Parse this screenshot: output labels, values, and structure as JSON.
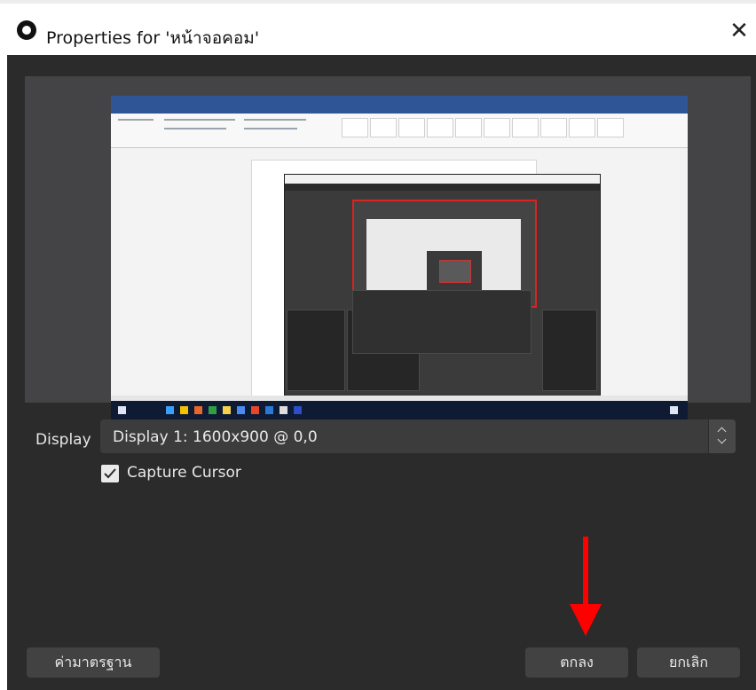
{
  "dialog": {
    "title": "Properties for 'หน้าจอคอม'",
    "close_glyph": "✕"
  },
  "preview": {
    "content": "screen-capture-preview"
  },
  "form": {
    "display_label": "Display",
    "display_value": "Display 1: 1600x900 @ 0,0",
    "capture_cursor_label": "Capture Cursor",
    "capture_cursor_checked": true
  },
  "buttons": {
    "defaults": "ค่ามาตรฐาน",
    "ok": "ตกลง",
    "cancel": "ยกเลิก"
  },
  "colors": {
    "window_bg": "#2b2b2b",
    "button_bg": "#424242",
    "annotation_arrow": "#ff0000",
    "preview_border": "#d22222"
  },
  "icons": {
    "app": "obs-logo-icon",
    "close": "close-icon",
    "checkbox": "checkmark-icon",
    "spin": "updown-chevron-icon",
    "annotation": "red-down-arrow-icon"
  }
}
